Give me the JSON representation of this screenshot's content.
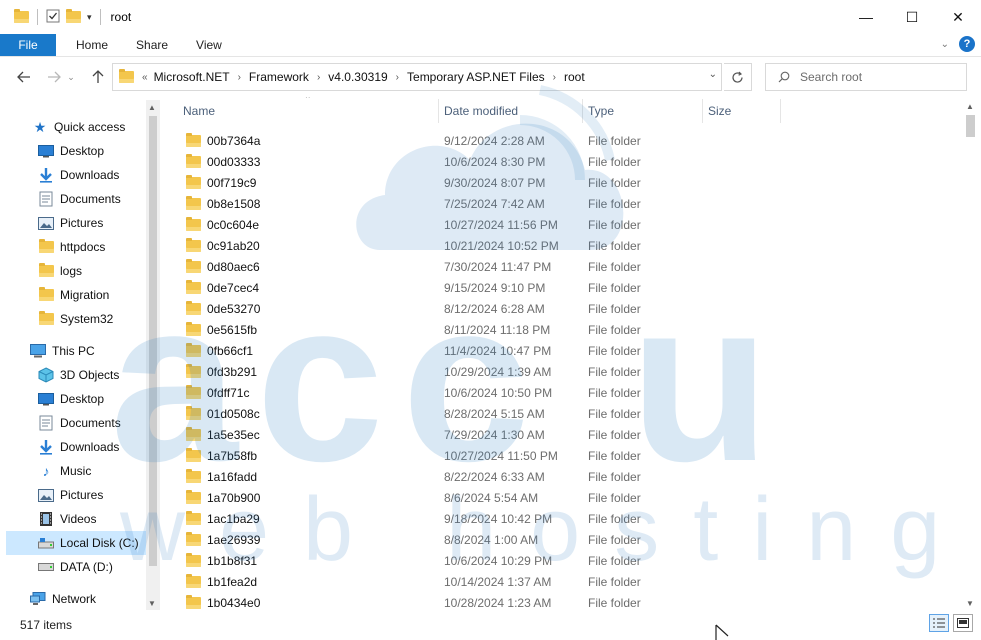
{
  "window": {
    "title": "root",
    "minimize_glyph": "—",
    "maximize_glyph": "☐",
    "close_glyph": "✕"
  },
  "ribbon": {
    "tabs": [
      "File",
      "Home",
      "Share",
      "View"
    ],
    "help_glyph": "?"
  },
  "address": {
    "overflow": "«",
    "crumbs": [
      "Microsoft.NET",
      "Framework",
      "v4.0.30319",
      "Temporary ASP.NET Files",
      "root"
    ]
  },
  "search": {
    "placeholder": "Search root"
  },
  "nav": {
    "quick_access": "Quick access",
    "quick_items": [
      "Desktop",
      "Downloads",
      "Documents",
      "Pictures",
      "httpdocs",
      "logs",
      "Migration",
      "System32"
    ],
    "this_pc": "This PC",
    "pc_items": [
      "3D Objects",
      "Desktop",
      "Documents",
      "Downloads",
      "Music",
      "Pictures",
      "Videos",
      "Local Disk (C:)",
      "DATA (D:)"
    ],
    "network": "Network"
  },
  "columns": {
    "name": "Name",
    "date": "Date modified",
    "type": "Type",
    "size": "Size"
  },
  "files": [
    {
      "name": "00b7364a",
      "date": "9/12/2024 2:28 AM",
      "type": "File folder"
    },
    {
      "name": "00d03333",
      "date": "10/6/2024 8:30 PM",
      "type": "File folder"
    },
    {
      "name": "00f719c9",
      "date": "9/30/2024 8:07 PM",
      "type": "File folder"
    },
    {
      "name": "0b8e1508",
      "date": "7/25/2024 7:42 AM",
      "type": "File folder"
    },
    {
      "name": "0c0c604e",
      "date": "10/27/2024 11:56 PM",
      "type": "File folder"
    },
    {
      "name": "0c91ab20",
      "date": "10/21/2024 10:52 PM",
      "type": "File folder"
    },
    {
      "name": "0d80aec6",
      "date": "7/30/2024 11:47 PM",
      "type": "File folder"
    },
    {
      "name": "0de7cec4",
      "date": "9/15/2024 9:10 PM",
      "type": "File folder"
    },
    {
      "name": "0de53270",
      "date": "8/12/2024 6:28 AM",
      "type": "File folder"
    },
    {
      "name": "0e5615fb",
      "date": "8/11/2024 11:18 PM",
      "type": "File folder"
    },
    {
      "name": "0fb66cf1",
      "date": "11/4/2024 10:47 PM",
      "type": "File folder"
    },
    {
      "name": "0fd3b291",
      "date": "10/29/2024 1:39 AM",
      "type": "File folder"
    },
    {
      "name": "0fdff71c",
      "date": "10/6/2024 10:50 PM",
      "type": "File folder"
    },
    {
      "name": "01d0508c",
      "date": "8/28/2024 5:15 AM",
      "type": "File folder"
    },
    {
      "name": "1a5e35ec",
      "date": "7/29/2024 1:30 AM",
      "type": "File folder"
    },
    {
      "name": "1a7b58fb",
      "date": "10/27/2024 11:50 PM",
      "type": "File folder"
    },
    {
      "name": "1a16fadd",
      "date": "8/22/2024 6:33 AM",
      "type": "File folder"
    },
    {
      "name": "1a70b900",
      "date": "8/6/2024 5:54 AM",
      "type": "File folder"
    },
    {
      "name": "1ac1ba29",
      "date": "9/18/2024 10:42 PM",
      "type": "File folder"
    },
    {
      "name": "1ae26939",
      "date": "8/8/2024 1:00 AM",
      "type": "File folder"
    },
    {
      "name": "1b1b8f31",
      "date": "10/6/2024 10:29 PM",
      "type": "File folder"
    },
    {
      "name": "1b1fea2d",
      "date": "10/14/2024 1:37 AM",
      "type": "File folder"
    },
    {
      "name": "1b0434e0",
      "date": "10/28/2024 1:23 AM",
      "type": "File folder"
    }
  ],
  "status": {
    "count": "517 items"
  },
  "watermark": {
    "line1": "acc u",
    "line2": "web hosting",
    "color": "#2f7fc1"
  }
}
